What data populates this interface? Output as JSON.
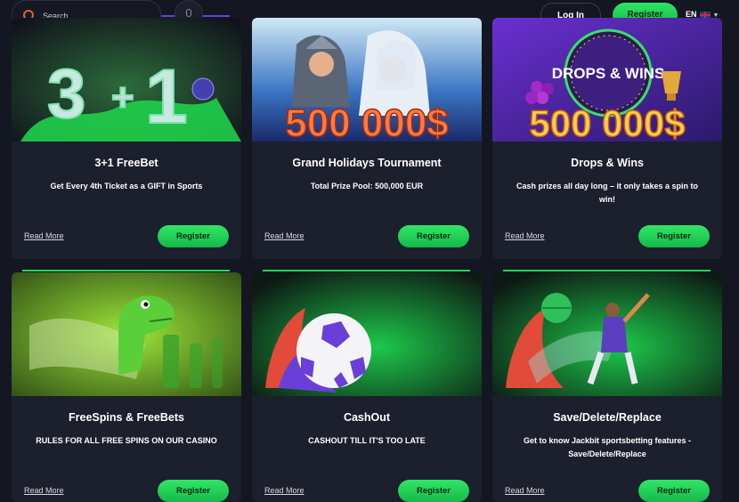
{
  "header": {
    "search_placeholder": "Search",
    "login_label": "Log In",
    "register_label": "Register",
    "language": "EN"
  },
  "cards": [
    {
      "title": "3+1 FreeBet",
      "description": "Get Every 4th Ticket as a GIFT in Sports",
      "read_more": "Read More",
      "register": "Register"
    },
    {
      "title": "Grand Holidays Tournament",
      "description": "Total Prize Pool: 500,000 EUR",
      "read_more": "Read More",
      "register": "Register",
      "banner_text": "500 000$"
    },
    {
      "title": "Drops & Wins",
      "description": "Cash prizes all day long – it only takes a spin to win!",
      "read_more": "Read More",
      "register": "Register",
      "banner_text": "500 000$",
      "badge": "DROPS & WINS"
    },
    {
      "title": "FreeSpins & FreeBets",
      "description": "RULES FOR ALL FREE SPINS ON OUR CASINO",
      "read_more": "Read More",
      "register": "Register"
    },
    {
      "title": "CashOut",
      "description": "CASHOUT TILL IT'S TOO LATE",
      "read_more": "Read More",
      "register": "Register"
    },
    {
      "title": "Save/Delete/Replace",
      "description": "Get to know Jackbit sportsbetting features - Save/Delete/Replace",
      "read_more": "Read More",
      "register": "Register"
    }
  ],
  "colors": {
    "accent_green": "#22d35a",
    "background": "#141722",
    "card": "#1c1f2c",
    "search_icon": "#e2632d"
  },
  "icons": [
    "search-icon",
    "microphone-icon",
    "uk-flag-icon",
    "chevron-down-icon"
  ]
}
